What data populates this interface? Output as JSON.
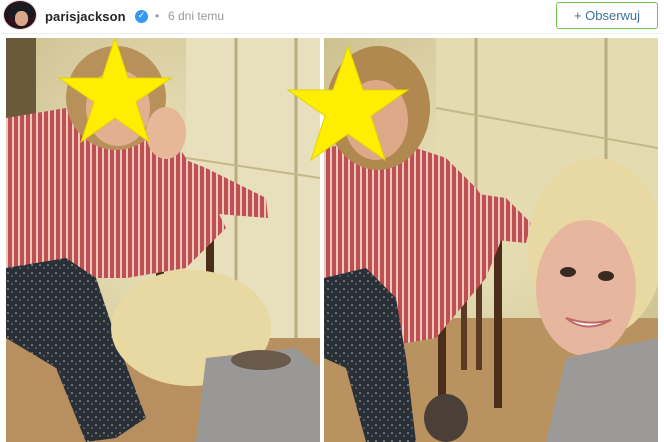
{
  "post": {
    "username": "parisjackson",
    "verified_icon": "verified-badge-icon",
    "separator": "•",
    "timestamp": "6 dni temu",
    "follow_label": "+ Obserwuj"
  },
  "image": {
    "panels": [
      "left-photo",
      "right-photo"
    ],
    "overlay_icon": "star-icon",
    "colors": {
      "star": "#ffee00",
      "shirt": "#a83a3a",
      "wall": "#e4dbb0",
      "hair_blonde": "#e8d9a2"
    }
  }
}
